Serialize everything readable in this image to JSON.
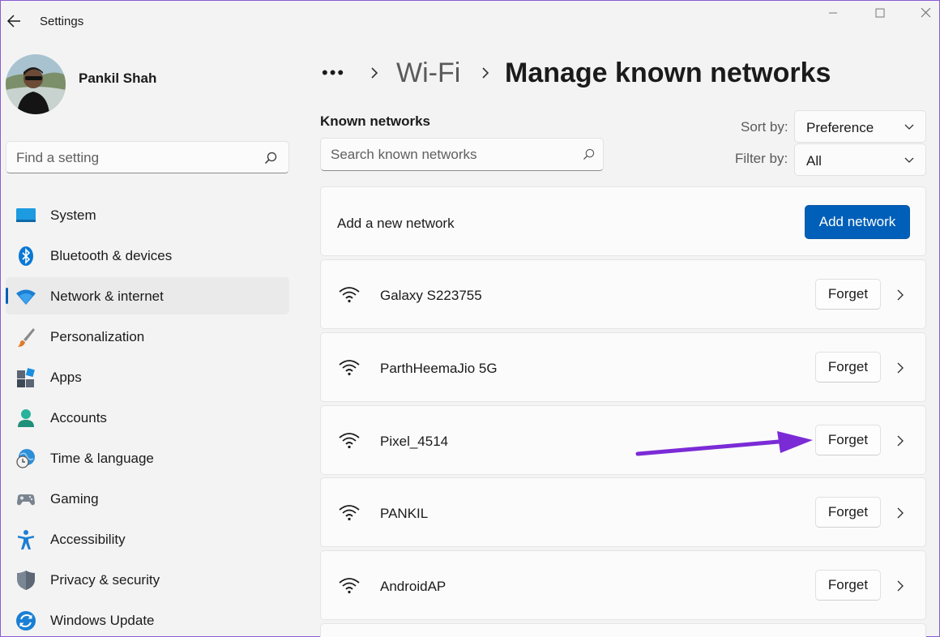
{
  "window": {
    "title": "Settings"
  },
  "profile": {
    "name": "Pankil Shah"
  },
  "search": {
    "placeholder": "Find a setting"
  },
  "sidebar": {
    "items": [
      {
        "label": "System",
        "icon": "system-icon",
        "active": false
      },
      {
        "label": "Bluetooth & devices",
        "icon": "bluetooth-icon",
        "active": false
      },
      {
        "label": "Network & internet",
        "icon": "network-icon",
        "active": true
      },
      {
        "label": "Personalization",
        "icon": "brush-icon",
        "active": false
      },
      {
        "label": "Apps",
        "icon": "apps-icon",
        "active": false
      },
      {
        "label": "Accounts",
        "icon": "accounts-icon",
        "active": false
      },
      {
        "label": "Time & language",
        "icon": "globe-clock-icon",
        "active": false
      },
      {
        "label": "Gaming",
        "icon": "gamepad-icon",
        "active": false
      },
      {
        "label": "Accessibility",
        "icon": "accessibility-icon",
        "active": false
      },
      {
        "label": "Privacy & security",
        "icon": "shield-icon",
        "active": false
      },
      {
        "label": "Windows Update",
        "icon": "update-icon",
        "active": false
      }
    ]
  },
  "breadcrumb": {
    "overflow": "•••",
    "parent": "Wi-Fi",
    "current": "Manage known networks"
  },
  "known_networks": {
    "title": "Known networks",
    "search_placeholder": "Search known networks",
    "sort_label": "Sort by:",
    "sort_value": "Preference",
    "filter_label": "Filter by:",
    "filter_value": "All",
    "add_label": "Add a new network",
    "add_button": "Add network",
    "forget_label": "Forget",
    "networks": [
      {
        "name": "Galaxy S223755"
      },
      {
        "name": "ParthHeemaJio 5G"
      },
      {
        "name": "Pixel_4514"
      },
      {
        "name": "PANKIL"
      },
      {
        "name": "AndroidAP"
      }
    ]
  },
  "colors": {
    "accent": "#005fb8",
    "annotation_arrow": "#7b2bd6"
  }
}
